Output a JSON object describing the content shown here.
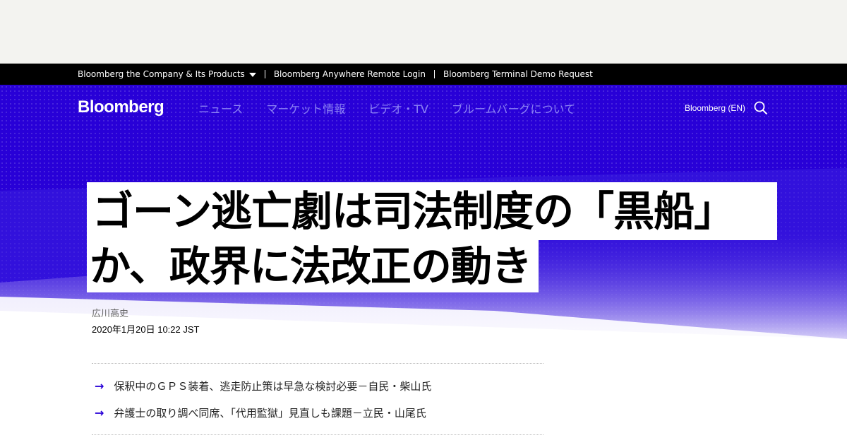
{
  "utility_bar": {
    "items": [
      "Bloomberg the Company & Its Products",
      "Bloomberg Anywhere Remote Login",
      "Bloomberg Terminal Demo Request"
    ]
  },
  "nav": {
    "logo": "Bloomberg",
    "links": [
      "ニュース",
      "マーケット情報",
      "ビデオ・TV",
      "ブルームバーグについて"
    ],
    "lang_link": "Bloomberg (EN)",
    "search_icon": "search-icon"
  },
  "article": {
    "headline_line1": "ゴーン逃亡劇は司法制度の「黒船」",
    "headline_line2": "か、政界に法改正の動き",
    "author": "広川高史",
    "date": "2020年1月20日 10:22 JST",
    "abstract": [
      "保釈中のＧＰＳ装着、逃走防止策は早急な検討必要－自民・柴山氏",
      "弁護士の取り調べ同席、「代用監獄」見直しも課題－立民・山尾氏"
    ]
  },
  "colors": {
    "brand_blue": "#2800d7",
    "nav_link": "#8c82f5",
    "utility_bar_bg": "#000000",
    "ad_bg": "#f3f3f0"
  }
}
